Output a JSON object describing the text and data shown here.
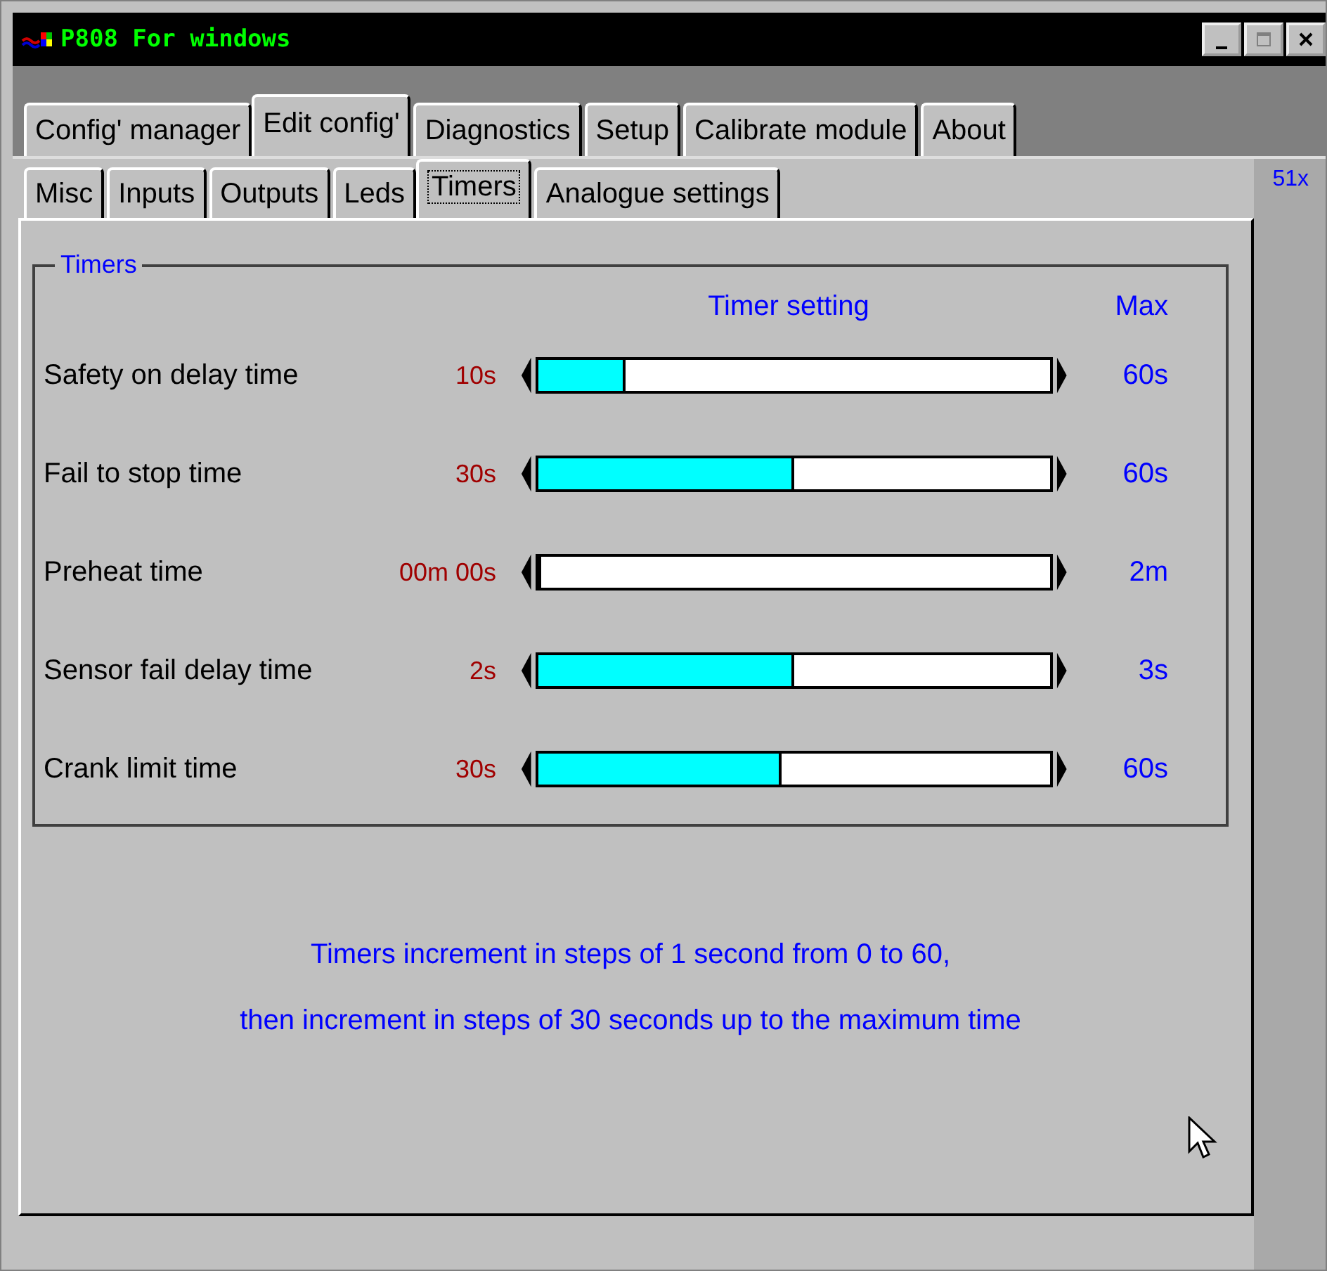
{
  "window": {
    "title": "P808 For windows"
  },
  "tabs": [
    {
      "label": "Config' manager",
      "selected": false
    },
    {
      "label": "Edit config'",
      "selected": true
    },
    {
      "label": "Diagnostics",
      "selected": false
    },
    {
      "label": "Setup",
      "selected": false
    },
    {
      "label": "Calibrate module",
      "selected": false
    },
    {
      "label": "About",
      "selected": false
    }
  ],
  "corner_text": "51x",
  "subtabs": [
    {
      "label": "Misc",
      "selected": false
    },
    {
      "label": "Inputs",
      "selected": false
    },
    {
      "label": "Outputs",
      "selected": false
    },
    {
      "label": "Leds",
      "selected": false
    },
    {
      "label": "Timers",
      "selected": true
    },
    {
      "label": "Analogue settings",
      "selected": false
    }
  ],
  "group": {
    "title": "Timers",
    "setting_header": "Timer setting",
    "max_header": "Max",
    "timers": [
      {
        "name": "Safety on delay time",
        "value": "10s",
        "level": 0.17,
        "max": "60s"
      },
      {
        "name": "Fail to stop time",
        "value": "30s",
        "level": 0.5,
        "max": "60s"
      },
      {
        "name": "Preheat time",
        "value": "00m 00s",
        "level": 0,
        "max": "2m"
      },
      {
        "name": "Sensor fail delay time",
        "value": "2s",
        "level": 0.5,
        "max": "3s"
      },
      {
        "name": "Crank limit time",
        "value": "30s",
        "level": 0.475,
        "max": "60s"
      }
    ]
  },
  "notes": [
    "Timers increment in steps of 1 second from 0 to 60,",
    "then increment in steps of 30 seconds up to the maximum time"
  ]
}
